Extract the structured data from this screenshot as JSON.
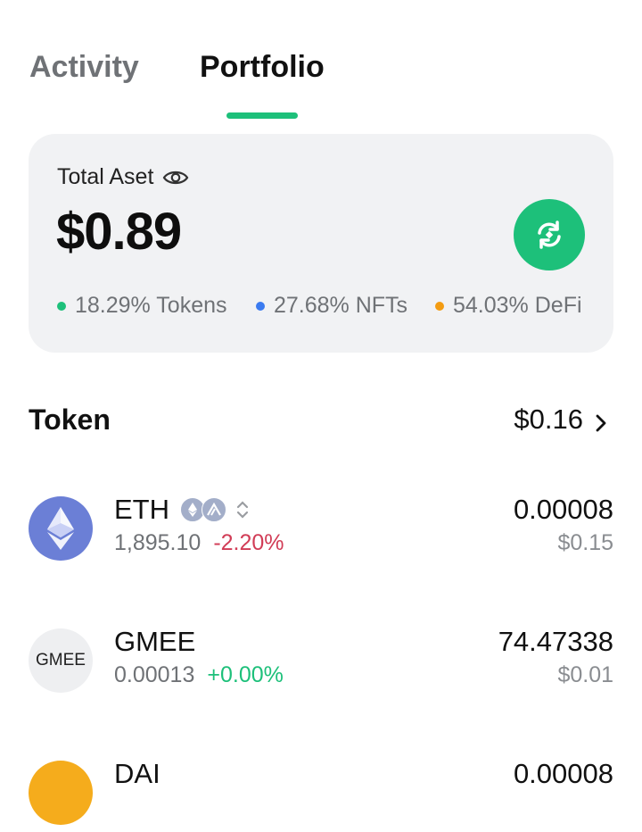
{
  "tabs": {
    "activity": "Activity",
    "portfolio": "Portfolio",
    "active": "Portfolio",
    "accent_color": "#1dc07a"
  },
  "asset_card": {
    "title": "Total Aset",
    "value": "$0.89",
    "icons": {
      "visibility": "eye-icon",
      "refresh": "refresh-icon"
    },
    "breakdown": [
      {
        "label": "18.29% Tokens",
        "color": "#1dc07a"
      },
      {
        "label": "27.68% NFTs",
        "color": "#3b7bf0"
      },
      {
        "label": "54.03% DeFi",
        "color": "#f39c12"
      }
    ]
  },
  "tokens": {
    "title": "Token",
    "total": "$0.16",
    "items": [
      {
        "symbol": "ETH",
        "price": "1,895.10",
        "change": "-2.20%",
        "amount": "0.00008",
        "usd": "$0.15",
        "icon": "ethereum-icon",
        "chain_badges": [
          "ethereum-badge-icon",
          "arbitrum-badge-icon"
        ]
      },
      {
        "symbol": "GMEE",
        "price": "0.00013",
        "change": "+0.00%",
        "amount": "74.47338",
        "usd": "$0.01",
        "icon_text": "GMEE"
      },
      {
        "symbol": "DAI",
        "amount": "0.00008",
        "icon": "dai-icon"
      }
    ]
  }
}
